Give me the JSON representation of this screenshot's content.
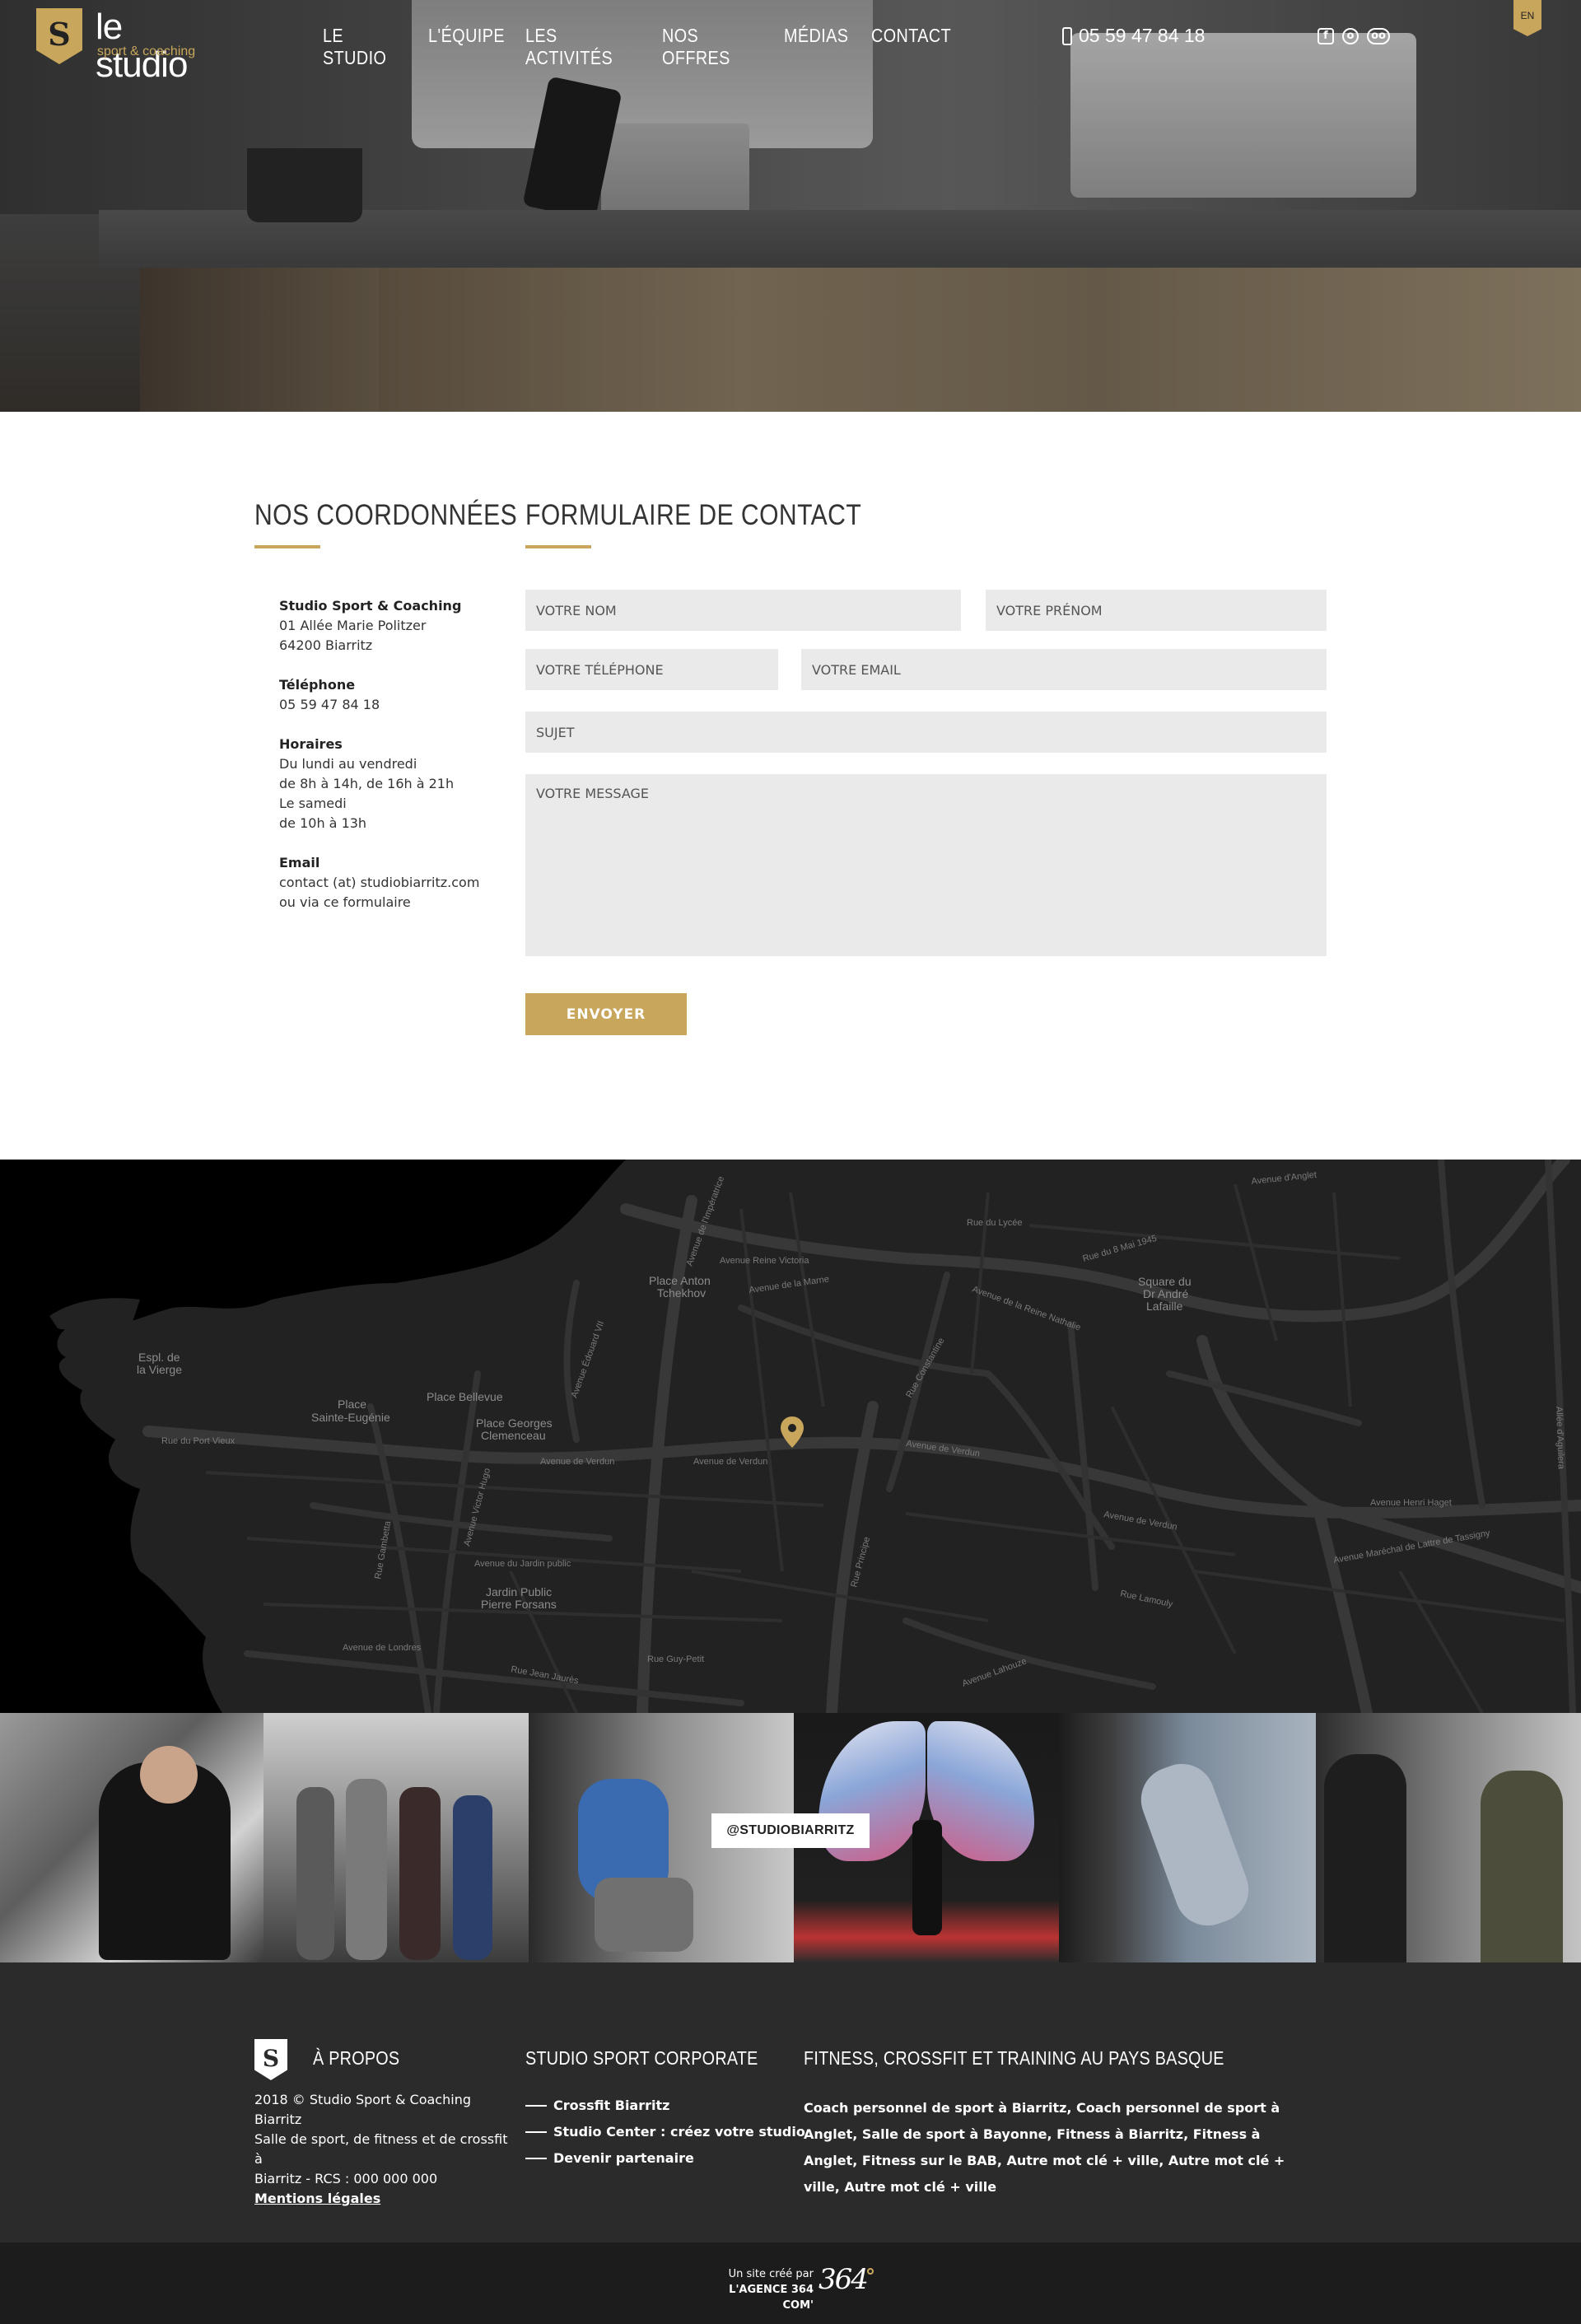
{
  "header": {
    "logo_name": "le studio",
    "logo_sub": "sport & coaching",
    "logo_letter": "S",
    "nav": [
      "LE STUDIO",
      "L'ÉQUIPE",
      "LES ACTIVITÉS",
      "NOS OFFRES",
      "MÉDIAS",
      "CONTACT"
    ],
    "phone": "05 59 47 84 18",
    "social_icons": [
      "facebook-icon",
      "instagram-icon",
      "tripadvisor-icon"
    ],
    "lang": "EN"
  },
  "contact": {
    "coords_title": "NOS COORDONNÉES",
    "form_title": "FORMULAIRE DE CONTACT",
    "info": {
      "company": "Studio Sport & Coaching",
      "address1": "01 Allée Marie Politzer",
      "address2": "64200 Biarritz",
      "phone_label": "Téléphone",
      "phone": "05 59 47 84 18",
      "hours_label": "Horaires",
      "hours1": "Du lundi au vendredi",
      "hours2": "de 8h à 14h, de 16h à 21h",
      "hours3": "Le samedi",
      "hours4": "de 10h à 13h",
      "email_label": "Email",
      "email": "contact (at) studiobiarritz.com",
      "email_alt": "ou via ce formulaire"
    },
    "form": {
      "nom_placeholder": "VOTRE NOM",
      "prenom_placeholder": "VOTRE PRÉNOM",
      "tel_placeholder": "VOTRE TÉLÉPHONE",
      "email_placeholder": "VOTRE EMAIL",
      "sujet_placeholder": "SUJET",
      "message_placeholder": "VOTRE MESSAGE",
      "submit_label": "ENVOYER"
    }
  },
  "map": {
    "labels": {
      "esplanade": [
        "Espl. de",
        "la Vierge"
      ],
      "sainte_eugenie": [
        "Place",
        "Sainte-Eugénie"
      ],
      "bellevue": "Place Bellevue",
      "clemenceau": [
        "Place Georges",
        "Clemenceau"
      ],
      "tchekhov": [
        "Place Anton",
        "Tchekhov"
      ],
      "lafaille": [
        "Square du",
        "Dr André",
        "Lafaille"
      ],
      "jardin_public": [
        "Jardin Public",
        "Pierre Forsans"
      ],
      "verdun1": "Avenue de Verdun",
      "verdun2": "Avenue de Verdun",
      "verdun3": "Avenue de Verdun",
      "verdun4": "Avenue de Verdun",
      "reine_victoria": "Avenue Reine Victoria",
      "marne": "Avenue de la Marne",
      "reine_nathalie": "Avenue de la Reine Nathalie",
      "edouard": "Avenue Édouard VII",
      "victor_hugo": "Avenue Victor Hugo",
      "londres": "Avenue de Londres",
      "jean_jaures": "Rue Jean Jaurès",
      "henri_haget": "Avenue Henri Haget",
      "lattre": "Avenue Maréchal de Lattre de Tassigny",
      "anglet": "Avenue d'Anglet",
      "mai_1945": "Rue du 8 Mai 1945",
      "guy_petit": "Rue Guy-Petit",
      "gambetta": "Rue Gambetta",
      "aguilera": "Allée d'Aguilera",
      "imperatrice": "Avenue de l'Impératrice",
      "princip": "Rue Principe",
      "lahouze": "Avenue Lahouze",
      "port_vieux": "Rue du Port Vieux",
      "constantine": "Rue Constantine",
      "lycee": "Rue du Lycée",
      "jardin_ave": "Avenue du Jardin public",
      "lamouly": "Rue Lamouly"
    }
  },
  "instagram": {
    "handle": "@STUDIOBIARRITZ",
    "photos": [
      "photo-1",
      "photo-2",
      "photo-3",
      "photo-4",
      "photo-5",
      "photo-6"
    ]
  },
  "footer": {
    "logo_letter": "S",
    "about_title": "À PROPOS",
    "about_line1": "2018 © Studio Sport & Coaching Biarritz",
    "about_line2": "Salle de sport, de fitness et de crossfit à",
    "about_line3": "Biarritz - RCS : 000 000 000",
    "legal_link": "Mentions légales",
    "corp_title": "STUDIO SPORT CORPORATE",
    "corp_items": [
      "Crossfit Biarritz",
      "Studio Center : créez votre studio",
      "Devenir partenaire"
    ],
    "fitness_title": "FITNESS, CROSSFIT ET TRAINING AU PAYS BASQUE",
    "fitness_text": "Coach personnel de sport à Biarritz,  Coach personnel de sport à Anglet, Salle de sport à Bayonne, Fitness à Biarritz, Fitness à Anglet, Fitness sur le BAB, Autre mot clé + ville, Autre mot clé + ville, Autre mot clé + ville",
    "credit_line1": "Un site créé par",
    "credit_line2": "L'AGENCE 364 COM'",
    "agency_logo": "364"
  },
  "colors": {
    "gold": "#c8a65b",
    "dark_footer": "#2b2b2b",
    "bottom_bar": "#1c1c1c",
    "field_bg": "#eaeaea"
  }
}
